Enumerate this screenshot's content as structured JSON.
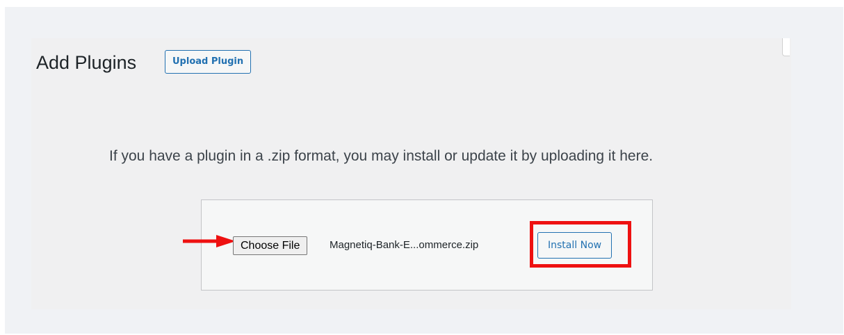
{
  "header": {
    "title": "Add Plugins",
    "upload_plugin_label": "Upload Plugin"
  },
  "upload": {
    "help_text": "If you have a plugin in a .zip format, you may install or update it by uploading it here.",
    "choose_file_label": "Choose File",
    "file_name": "Magnetiq-Bank-E...ommerce.zip",
    "install_now_label": "Install Now"
  },
  "annotations": {
    "arrow_color": "#ee1111",
    "highlight_color": "#ee1111",
    "arrow_icon": "right-arrow-icon"
  },
  "colors": {
    "accent": "#2271b1",
    "panel_background": "#f0f0f1",
    "title_text": "#1d2327"
  }
}
